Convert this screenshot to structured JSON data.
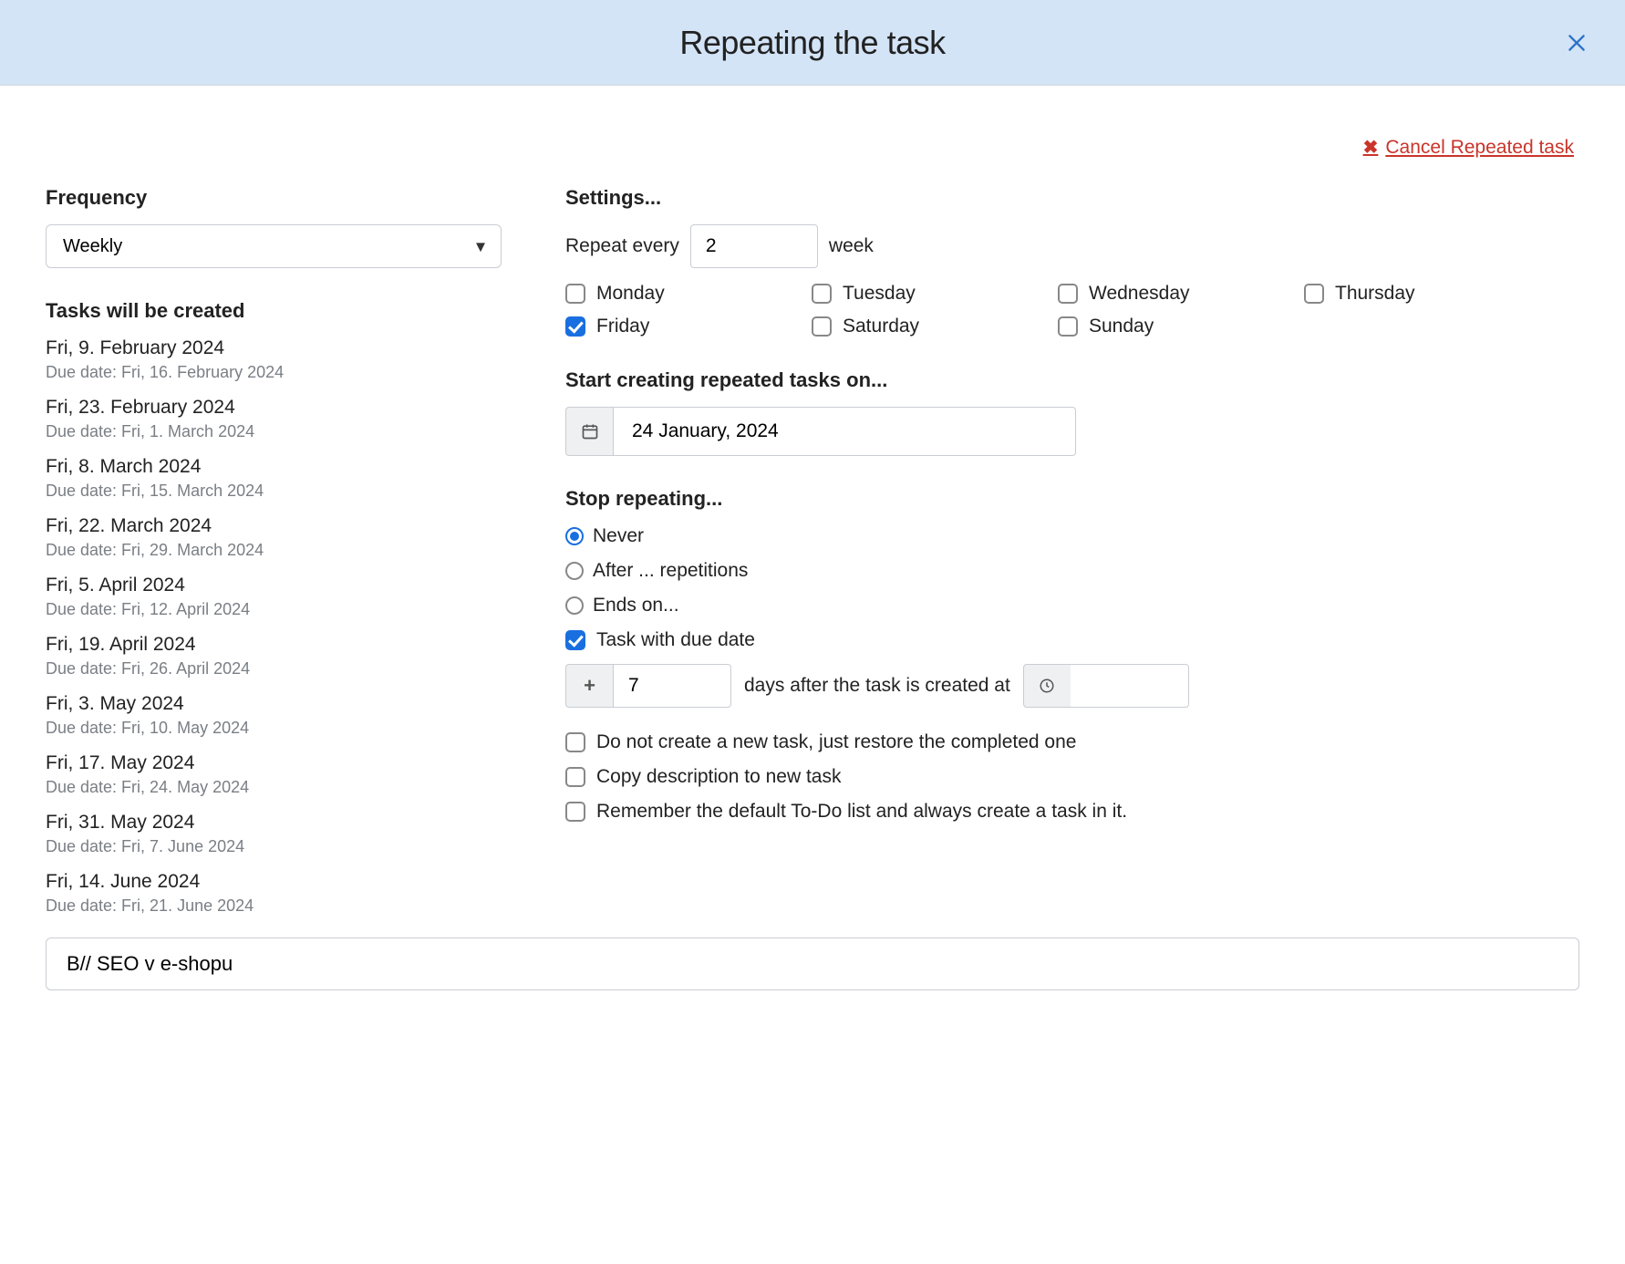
{
  "header": {
    "title": "Repeating the task"
  },
  "cancel_link": "Cancel Repeated task",
  "frequency": {
    "label": "Frequency",
    "selected": "Weekly"
  },
  "preview": {
    "label": "Tasks will be created",
    "items": [
      {
        "date": "Fri, 9. February 2024",
        "due": "Due date: Fri, 16. February 2024"
      },
      {
        "date": "Fri, 23. February 2024",
        "due": "Due date: Fri, 1. March 2024"
      },
      {
        "date": "Fri, 8. March 2024",
        "due": "Due date: Fri, 15. March 2024"
      },
      {
        "date": "Fri, 22. March 2024",
        "due": "Due date: Fri, 29. March 2024"
      },
      {
        "date": "Fri, 5. April 2024",
        "due": "Due date: Fri, 12. April 2024"
      },
      {
        "date": "Fri, 19. April 2024",
        "due": "Due date: Fri, 26. April 2024"
      },
      {
        "date": "Fri, 3. May 2024",
        "due": "Due date: Fri, 10. May 2024"
      },
      {
        "date": "Fri, 17. May 2024",
        "due": "Due date: Fri, 24. May 2024"
      },
      {
        "date": "Fri, 31. May 2024",
        "due": "Due date: Fri, 7. June 2024"
      },
      {
        "date": "Fri, 14. June 2024",
        "due": "Due date: Fri, 21. June 2024"
      }
    ]
  },
  "settings": {
    "label": "Settings...",
    "repeat_every_prefix": "Repeat every",
    "repeat_every_value": "2",
    "repeat_every_suffix": "week",
    "days": {
      "monday": {
        "label": "Monday",
        "checked": false
      },
      "tuesday": {
        "label": "Tuesday",
        "checked": false
      },
      "wednesday": {
        "label": "Wednesday",
        "checked": false
      },
      "thursday": {
        "label": "Thursday",
        "checked": false
      },
      "friday": {
        "label": "Friday",
        "checked": true
      },
      "saturday": {
        "label": "Saturday",
        "checked": false
      },
      "sunday": {
        "label": "Sunday",
        "checked": false
      }
    },
    "start": {
      "label": "Start creating repeated tasks on...",
      "value": "24 January, 2024"
    },
    "stop": {
      "label": "Stop repeating...",
      "options": {
        "never": "Never",
        "after": "After ... repetitions",
        "endson": "Ends on..."
      },
      "selected": "never"
    },
    "due": {
      "with_due_label": "Task with due date",
      "with_due_checked": true,
      "days_value": "7",
      "days_suffix": "days after the task is created at",
      "time_value": ""
    },
    "options": {
      "restore": {
        "label": "Do not create a new task, just restore the completed one",
        "checked": false
      },
      "copydesc": {
        "label": "Copy description to new task",
        "checked": false
      },
      "remember": {
        "label": "Remember the default To-Do list and always create a task in it.",
        "checked": false
      }
    }
  },
  "task_name": "B// SEO v e-shopu"
}
